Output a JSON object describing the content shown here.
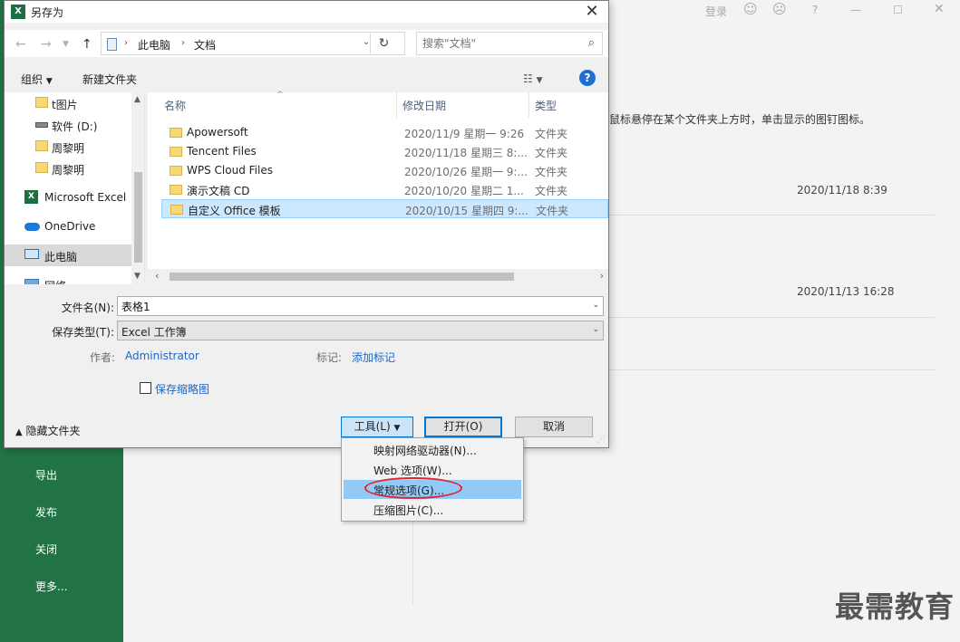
{
  "background": {
    "top_login": "登录",
    "nav": [
      "导出",
      "发布",
      "关闭",
      "更多..."
    ],
    "hint": "鼠标悬停在某个文件夹上方时，单击显示的图钉图标。",
    "dates": [
      "2020/11/18 8:39",
      "2020/11/13 16:28"
    ],
    "watermark": "最需教育"
  },
  "dialog": {
    "title": "另存为",
    "address": {
      "segments": [
        "此电脑",
        "文档"
      ]
    },
    "search_placeholder": "搜索\"文档\"",
    "toolbar": {
      "organize": "组织",
      "new_folder": "新建文件夹"
    },
    "sidebar": [
      {
        "label": "t图片",
        "icon": "folder-icon"
      },
      {
        "label": "软件 (D:)",
        "icon": "drive-icon"
      },
      {
        "label": "周黎明",
        "icon": "folder-icon"
      },
      {
        "label": "周黎明",
        "icon": "folder-icon"
      },
      {
        "label": "Microsoft Excel",
        "icon": "excel-icon"
      },
      {
        "label": "OneDrive",
        "icon": "cloud-icon"
      },
      {
        "label": "此电脑",
        "icon": "computer-icon"
      },
      {
        "label": "网络",
        "icon": "network-icon"
      }
    ],
    "columns": {
      "name": "名称",
      "date": "修改日期",
      "type": "类型"
    },
    "files": [
      {
        "name": "Apowersoft",
        "date": "2020/11/9 星期一 9:26",
        "type": "文件夹"
      },
      {
        "name": "Tencent Files",
        "date": "2020/11/18 星期三 8:...",
        "type": "文件夹"
      },
      {
        "name": "WPS Cloud Files",
        "date": "2020/10/26 星期一 9:...",
        "type": "文件夹"
      },
      {
        "name": "演示文稿 CD",
        "date": "2020/10/20 星期二 1...",
        "type": "文件夹"
      },
      {
        "name": "自定义 Office 模板",
        "date": "2020/10/15 星期四 9:...",
        "type": "文件夹"
      }
    ],
    "filename_label": "文件名(N):",
    "filename_value": "表格1",
    "filetype_label": "保存类型(T):",
    "filetype_value": "Excel 工作簿",
    "author_label": "作者:",
    "author_value": "Administrator",
    "tags_label": "标记:",
    "tags_value": "添加标记",
    "thumbnail_label": "保存缩略图",
    "hide_folders": "隐藏文件夹",
    "tools_button": "工具(L)",
    "open_button": "打开(O)",
    "cancel_button": "取消"
  },
  "tools_menu": [
    "映射网络驱动器(N)...",
    "Web 选项(W)...",
    "常规选项(G)...",
    "压缩图片(C)..."
  ]
}
